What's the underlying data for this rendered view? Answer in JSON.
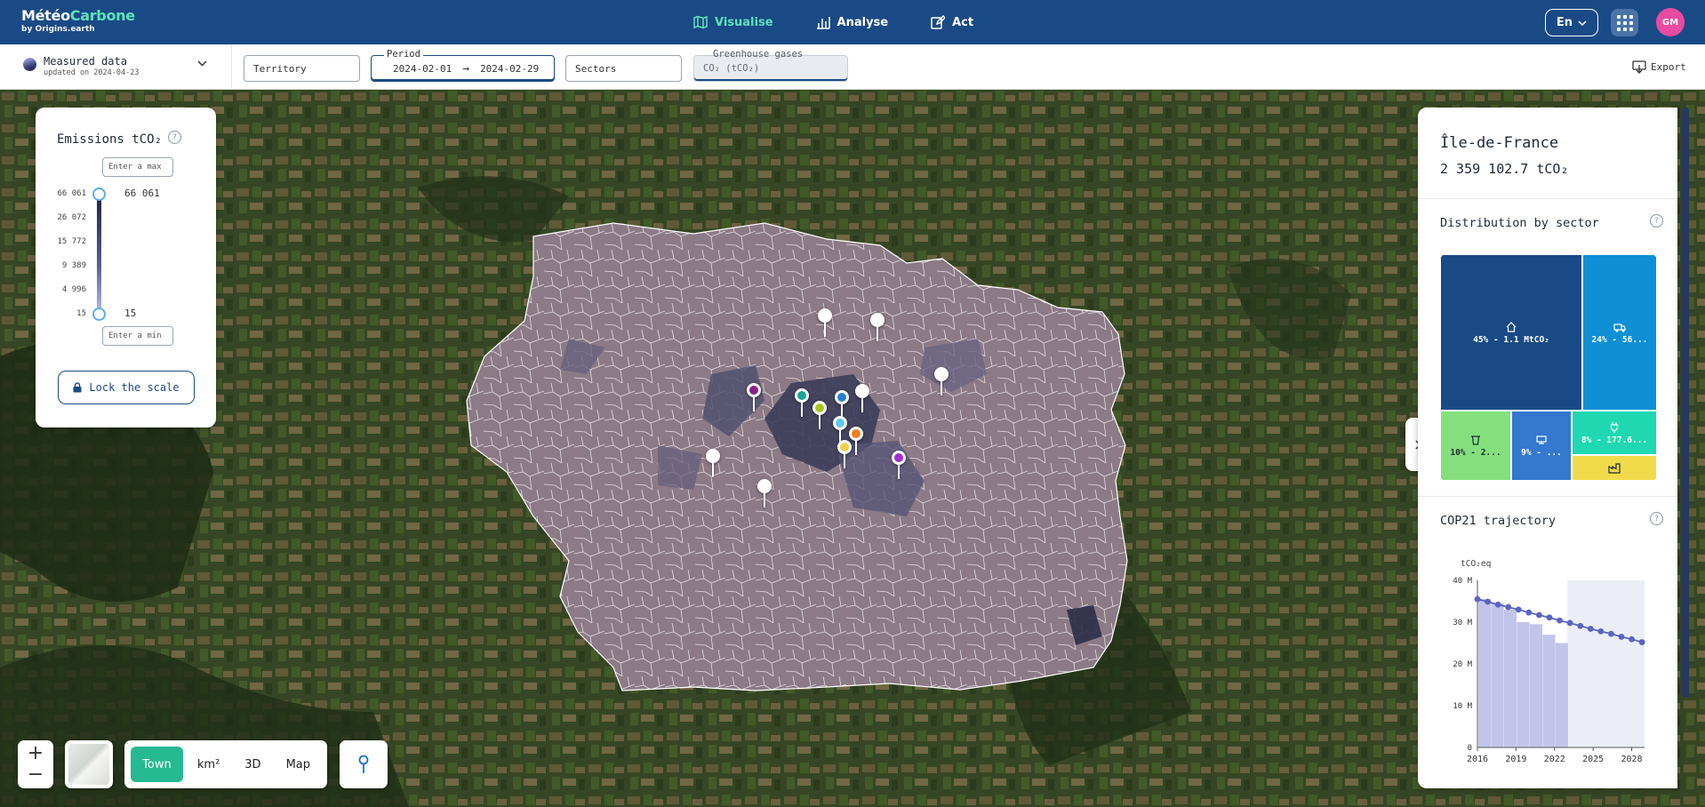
{
  "brand": {
    "name_a": "Météo",
    "name_b": "Carbone",
    "tagline": "by Origins.earth"
  },
  "nav": [
    {
      "label": "Visualise",
      "active": true
    },
    {
      "label": "Analyse",
      "active": false
    },
    {
      "label": "Act",
      "active": false
    }
  ],
  "header": {
    "language": "En",
    "avatar_initials": "GM"
  },
  "filters": {
    "dataset_title": "Measured data",
    "dataset_updated": "updated on 2024-04-23",
    "territory_placeholder": "Territory",
    "period_label": "Period",
    "period_start": "2024-02-01",
    "period_arrow": "→",
    "period_end": "2024-02-29",
    "sectors_placeholder": "Sectors",
    "ghg_label": "Greenhouse gases",
    "ghg_value": "CO₂ (tCO₂)",
    "export_label": "Export"
  },
  "legend": {
    "title": "Emissions tCO₂",
    "max_placeholder": "Enter a max",
    "min_placeholder": "Enter a min",
    "ticks": [
      "66 061",
      "26 072",
      "15 772",
      "9 389",
      "4 996",
      "15"
    ],
    "max_value": "66 061",
    "min_value": "15",
    "lock_label": "Lock the scale"
  },
  "map_controls": {
    "zoom_in": "+",
    "zoom_out": "−",
    "views": [
      {
        "label": "Town",
        "active": true
      },
      {
        "label": "km²",
        "active": false
      },
      {
        "label": "3D",
        "active": false
      },
      {
        "label": "Map",
        "active": false
      }
    ]
  },
  "map": {
    "markers": [
      {
        "color": "#ffffff"
      },
      {
        "color": "#ffffff"
      },
      {
        "color": "#ffffff"
      },
      {
        "color": "#8e1b8b"
      },
      {
        "color": "#17a598"
      },
      {
        "color": "#a7c51f"
      },
      {
        "color": "#2b7fd3"
      },
      {
        "color": "#ffffff"
      },
      {
        "color": "#5fc8e8"
      },
      {
        "color": "#ef7d22"
      },
      {
        "color": "#f0d24a"
      },
      {
        "color": "#a52ad6"
      },
      {
        "color": "#ffffff"
      },
      {
        "color": "#ffffff"
      }
    ]
  },
  "panel": {
    "region": "Île-de-France",
    "total": "2 359 102.7 tCO₂",
    "distribution_title": "Distribution by sector",
    "trajectory_title": "COP21 trajectory",
    "sectors": [
      {
        "label": "45% - 1.1 MtCO₂",
        "icon": "home-icon",
        "color": "#1a4a86"
      },
      {
        "label": "24% - 56...",
        "icon": "truck-icon",
        "color": "#0f8fd6"
      },
      {
        "label": "10% - 2...",
        "icon": "bin-icon",
        "color": "#83e07c"
      },
      {
        "label": "9% - ...",
        "icon": "building-icon",
        "color": "#3478cf"
      },
      {
        "label": "8% - 177.6...",
        "icon": "plug-icon",
        "color": "#1fd8b2"
      },
      {
        "label": "",
        "icon": "factory-icon",
        "color": "#f2db4a"
      }
    ]
  },
  "chart_data": {
    "type": "bar",
    "title": "COP21 trajectory",
    "ylabel": "tCO₂eq",
    "x": [
      2016,
      2017,
      2018,
      2019,
      2020,
      2021,
      2022,
      2023
    ],
    "yticks": [
      "0",
      "10 M",
      "20 M",
      "30 M",
      "40 M"
    ],
    "xticks": [
      "2016",
      "2019",
      "2022",
      "2025",
      "2028"
    ],
    "ylim": [
      0,
      40
    ],
    "xlim": [
      2016,
      2029
    ],
    "series": [
      {
        "values": [
          35.5,
          34.5,
          33,
          30,
          29.5,
          27,
          25,
          0
        ]
      }
    ],
    "trajectory": {
      "x": [
        2016,
        2016.8,
        2017.6,
        2018.4,
        2019.2,
        2020,
        2020.8,
        2021.6,
        2022.4,
        2023.2,
        2024,
        2024.8,
        2025.6,
        2026.4,
        2027.2,
        2028,
        2028.8
      ],
      "values": [
        35.5,
        34.9,
        34.2,
        33.6,
        33.0,
        32.3,
        31.7,
        31.1,
        30.4,
        29.8,
        29.1,
        28.4,
        27.8,
        27.2,
        26.5,
        25.9,
        25.2
      ]
    },
    "projection_end": 2029
  }
}
